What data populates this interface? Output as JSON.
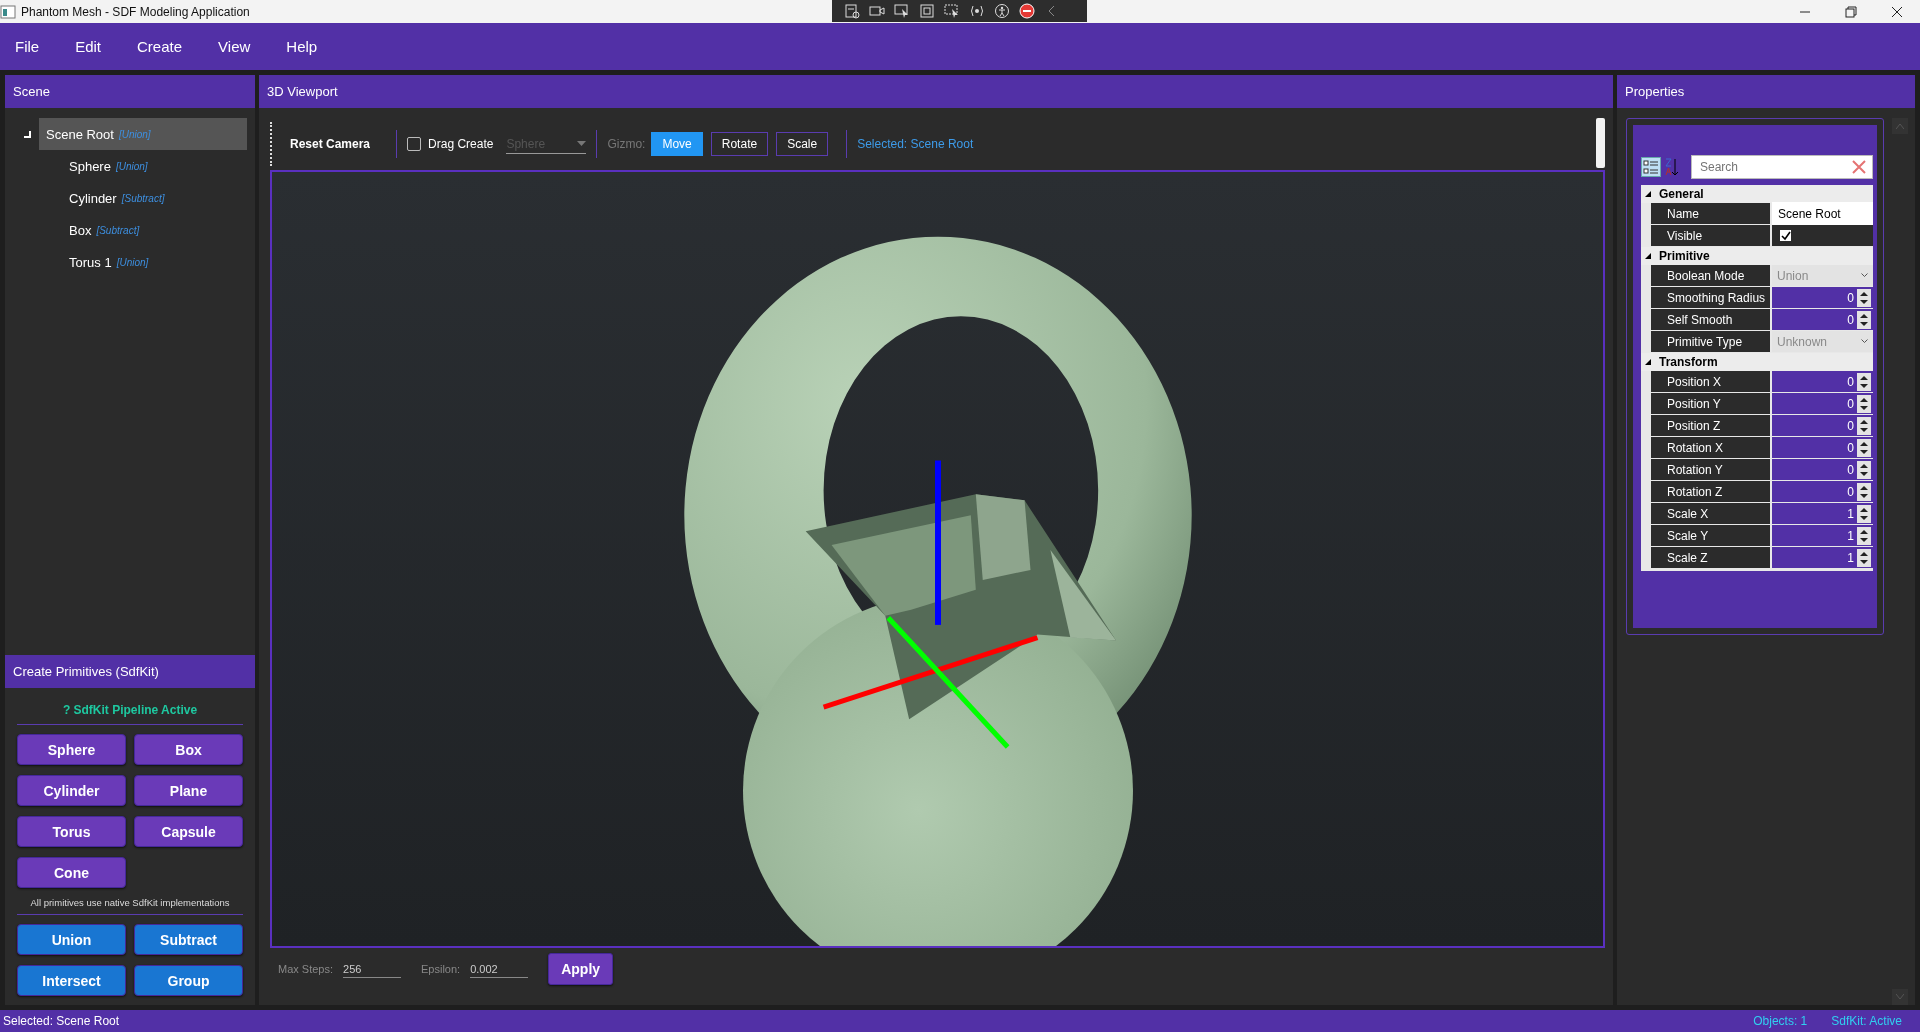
{
  "window": {
    "title": "Phantom Mesh - SDF Modeling Application"
  },
  "menu": [
    {
      "label": "File"
    },
    {
      "label": "Edit"
    },
    {
      "label": "Create"
    },
    {
      "label": "View"
    },
    {
      "label": "Help"
    }
  ],
  "scene": {
    "title": "Scene",
    "tree": [
      {
        "name": "Scene Root",
        "tag": "[Union]",
        "selected": true,
        "expanded": true,
        "children": [
          {
            "name": "Sphere",
            "tag": "[Union]",
            "selected": false
          },
          {
            "name": "Cylinder",
            "tag": "[Subtract]",
            "selected": false
          },
          {
            "name": "Box",
            "tag": "[Subtract]",
            "selected": false
          },
          {
            "name": "Torus 1",
            "tag": "[Union]",
            "selected": false
          }
        ]
      }
    ]
  },
  "create": {
    "title": "Create Primitives (SdfKit)",
    "status": "? SdfKit Pipeline Active",
    "primitives": [
      "Sphere",
      "Box",
      "Cylinder",
      "Plane",
      "Torus",
      "Capsule",
      "Cone"
    ],
    "note": "All primitives use native SdfKit implementations",
    "operations": [
      "Union",
      "Subtract",
      "Intersect",
      "Group"
    ]
  },
  "viewport": {
    "title": "3D Viewport",
    "toolbar": {
      "reset": "Reset Camera",
      "drag_create": {
        "label": "Drag Create",
        "checked": false
      },
      "shape": {
        "value": "Sphere",
        "disabled": true
      },
      "gizmo_label": "Gizmo:",
      "gizmo_modes": [
        {
          "label": "Move",
          "selected": true
        },
        {
          "label": "Rotate",
          "selected": false
        },
        {
          "label": "Scale",
          "selected": false
        }
      ],
      "selection": "Selected: Scene Root"
    },
    "settings": {
      "max_steps": {
        "label": "Max Steps:",
        "value": "256"
      },
      "epsilon": {
        "label": "Epsilon:",
        "value": "0.002"
      },
      "apply": "Apply"
    }
  },
  "properties": {
    "title": "Properties",
    "search": {
      "placeholder": "Search"
    },
    "categories": [
      {
        "name": "General",
        "expanded": true,
        "rows": [
          {
            "label": "Name",
            "kind": "text",
            "value": "Scene Root"
          },
          {
            "label": "Visible",
            "kind": "check",
            "checked": true
          }
        ]
      },
      {
        "name": "Primitive",
        "expanded": true,
        "rows": [
          {
            "label": "Boolean Mode",
            "kind": "combo",
            "value": "Union",
            "disabled": true
          },
          {
            "label": "Smoothing Radius",
            "kind": "number",
            "value": "0"
          },
          {
            "label": "Self Smooth",
            "kind": "number",
            "value": "0"
          },
          {
            "label": "Primitive Type",
            "kind": "combo",
            "value": "Unknown",
            "disabled": true
          }
        ]
      },
      {
        "name": "Transform",
        "expanded": true,
        "rows": [
          {
            "label": "Position X",
            "kind": "number",
            "value": "0"
          },
          {
            "label": "Position Y",
            "kind": "number",
            "value": "0"
          },
          {
            "label": "Position Z",
            "kind": "number",
            "value": "0"
          },
          {
            "label": "Rotation X",
            "kind": "number",
            "value": "0"
          },
          {
            "label": "Rotation Y",
            "kind": "number",
            "value": "0"
          },
          {
            "label": "Rotation Z",
            "kind": "number",
            "value": "0"
          },
          {
            "label": "Scale X",
            "kind": "number",
            "value": "1"
          },
          {
            "label": "Scale Y",
            "kind": "number",
            "value": "1"
          },
          {
            "label": "Scale Z",
            "kind": "number",
            "value": "1"
          }
        ]
      }
    ]
  },
  "status_bar": {
    "selection": "Selected: Scene Root",
    "objects": "Objects: 1",
    "engine": "SdfKit: Active"
  }
}
